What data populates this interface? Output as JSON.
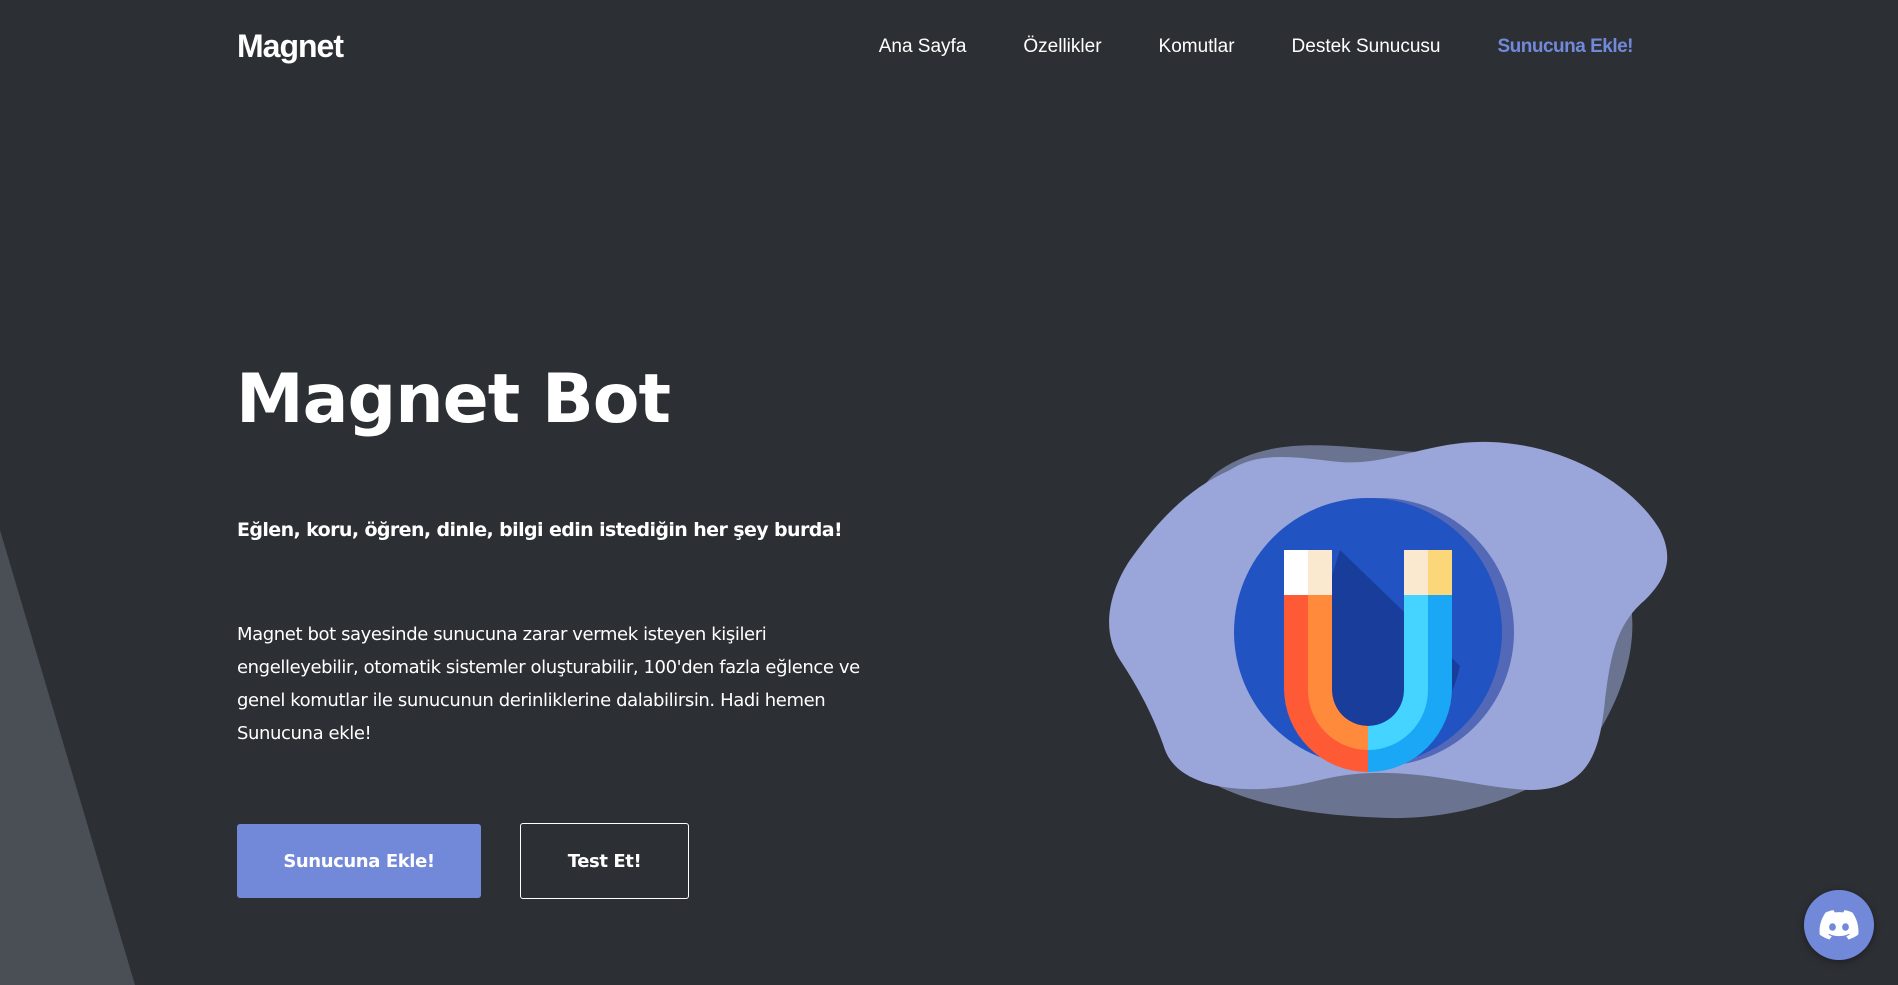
{
  "nav": {
    "brand": "Magnet",
    "links": [
      {
        "label": "Ana Sayfa"
      },
      {
        "label": "Özellikler"
      },
      {
        "label": "Komutlar"
      },
      {
        "label": "Destek Sunucusu"
      },
      {
        "label": "Sunucuna Ekle!"
      }
    ]
  },
  "hero": {
    "title": "Magnet Bot",
    "tagline": "Eğlen, koru, öğren, dinle, bilgi edin istediğin her şey burda!",
    "description": "Magnet bot sayesinde sunucuna zarar vermek isteyen kişileri engelleyebilir, otomatik sistemler oluşturabilir, 100'den fazla eğlence ve genel komutlar ile sunucunun derinliklerine dalabilirsin. Hadi hemen Sunucuna ekle!",
    "primary_button": "Sunucuna Ekle!",
    "secondary_button": "Test Et!"
  },
  "illustration": {
    "icon": "magnet-icon"
  },
  "fab": {
    "icon": "discord-icon"
  },
  "colors": {
    "background": "#2c2f34",
    "accent": "#7289da",
    "blob": "#9aa6d9",
    "blob_shadow": "#6a7390"
  }
}
